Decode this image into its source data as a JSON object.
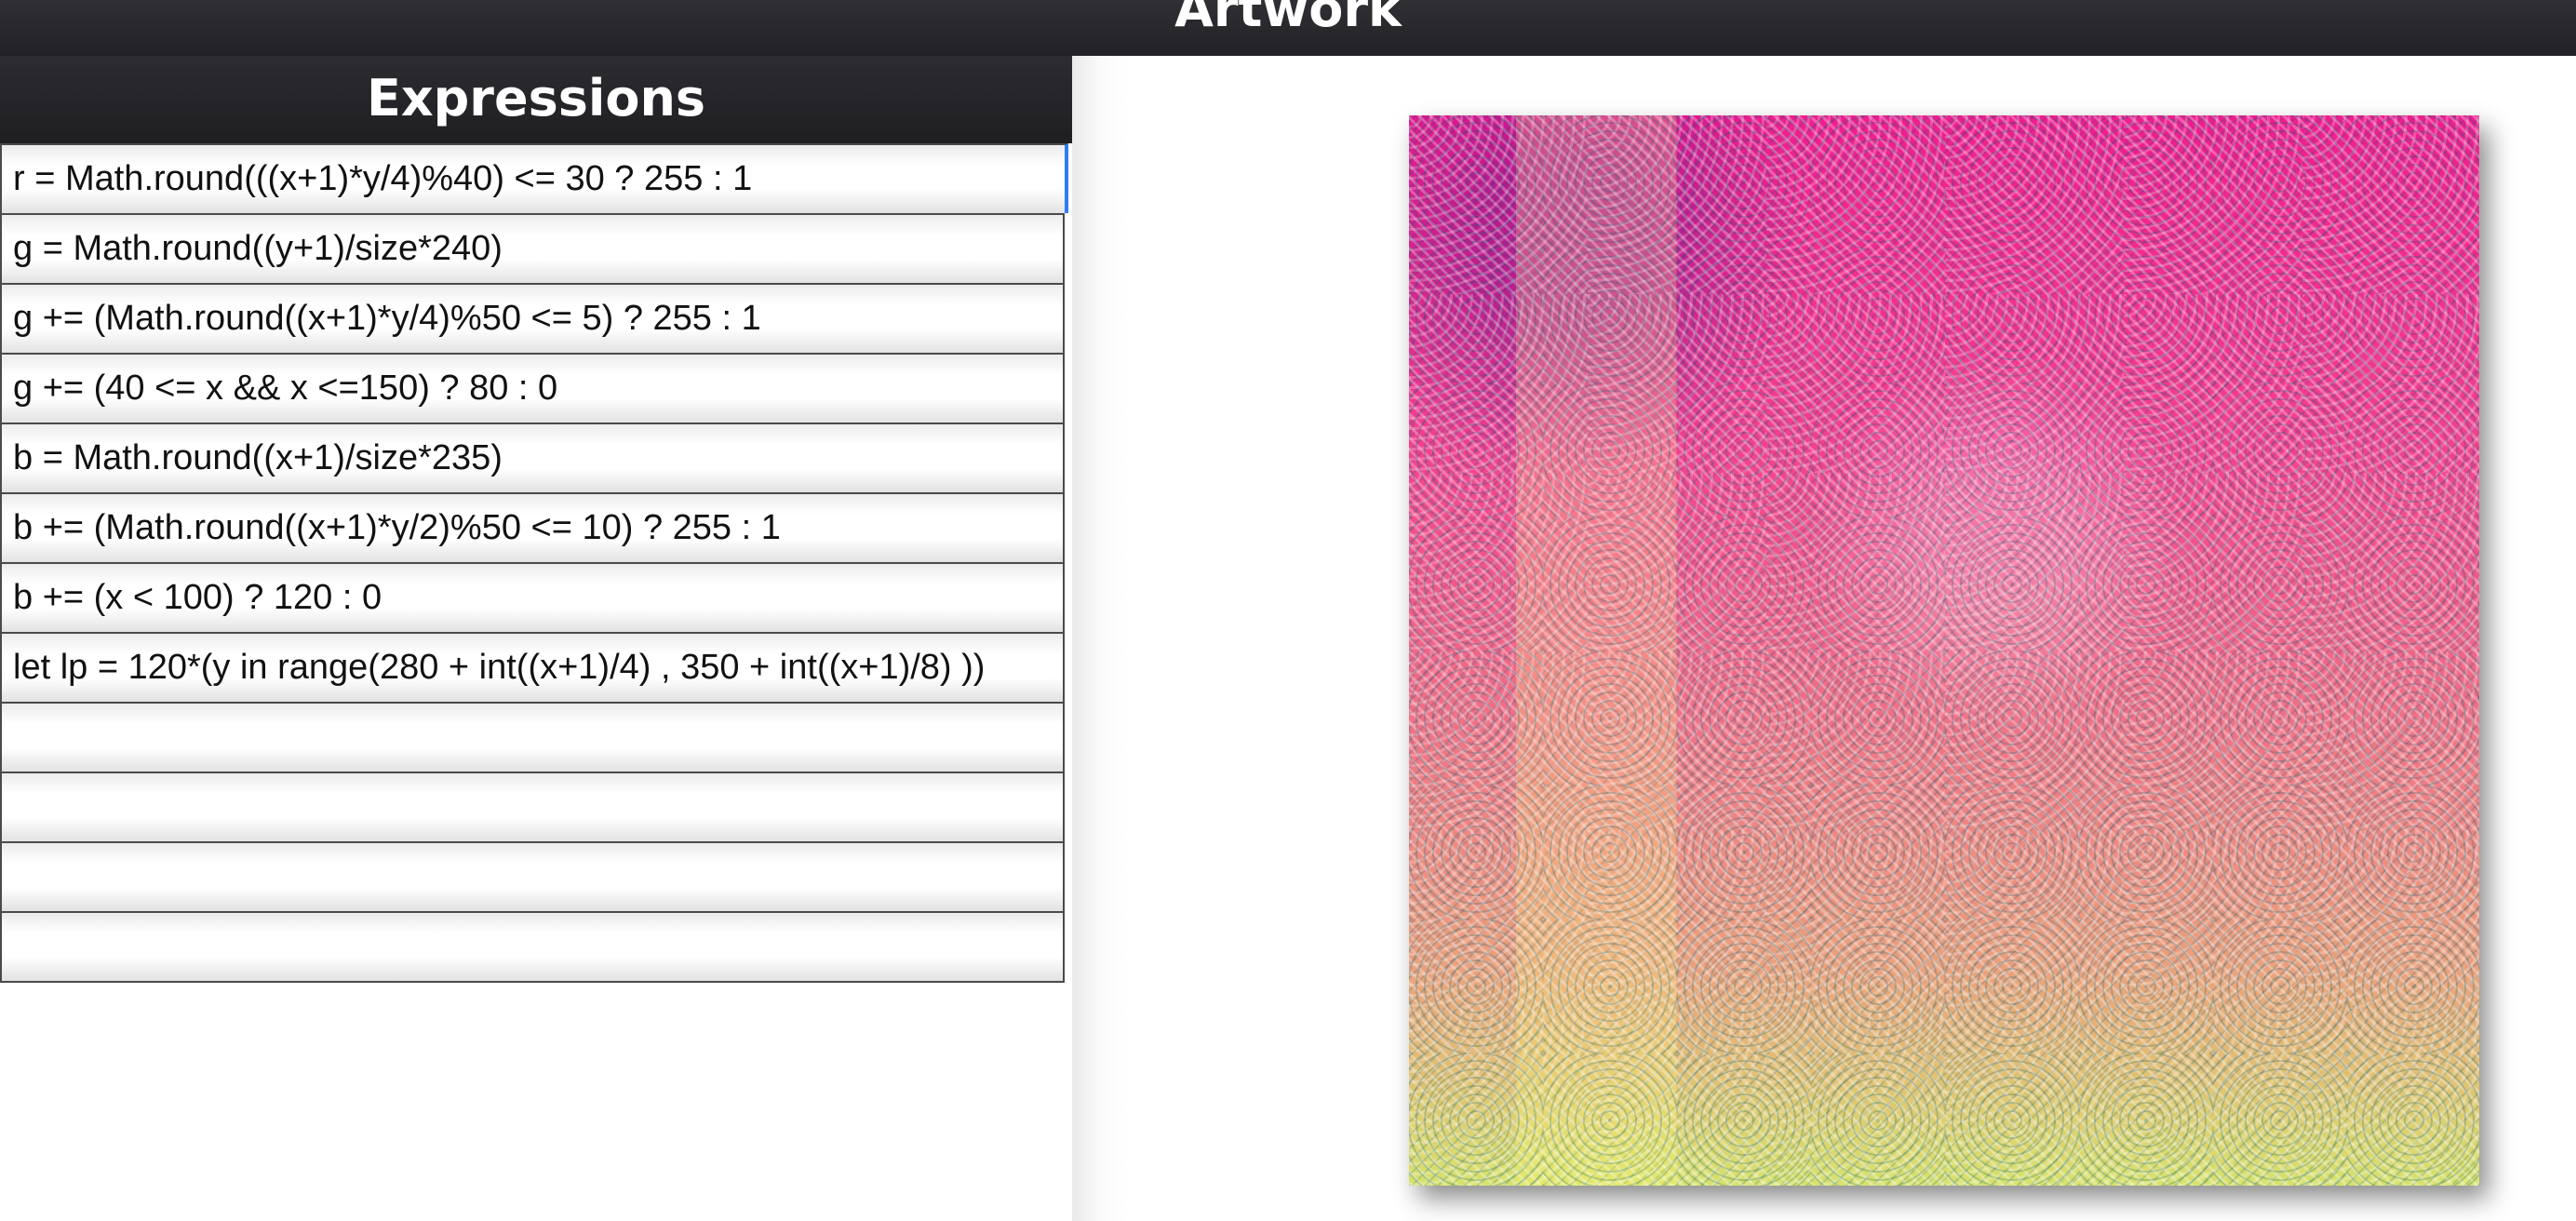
{
  "header": {
    "title": "Artwork"
  },
  "expressions_panel": {
    "title": "Expressions",
    "rows": [
      "r = Math.round(((x+1)*y/4)%40) <= 30 ? 255 : 1",
      "g = Math.round((y+1)/size*240)",
      "g += (Math.round((x+1)*y/4)%50 <= 5) ? 255 : 1",
      "g += (40 <= x && x <=150) ? 80 : 0",
      "b = Math.round((x+1)/size*235)",
      "b += (Math.round((x+1)*y/2)%50 <= 10) ? 255 : 1",
      "b += (x < 100) ? 120 : 0",
      "let lp = 120*(y in range(280 + int((x+1)/4) , 350 + int((x+1)/8) ))",
      "",
      "",
      "",
      ""
    ]
  },
  "colors": {
    "header_bg": "#252529",
    "active_row_accent": "#2f7df0"
  }
}
